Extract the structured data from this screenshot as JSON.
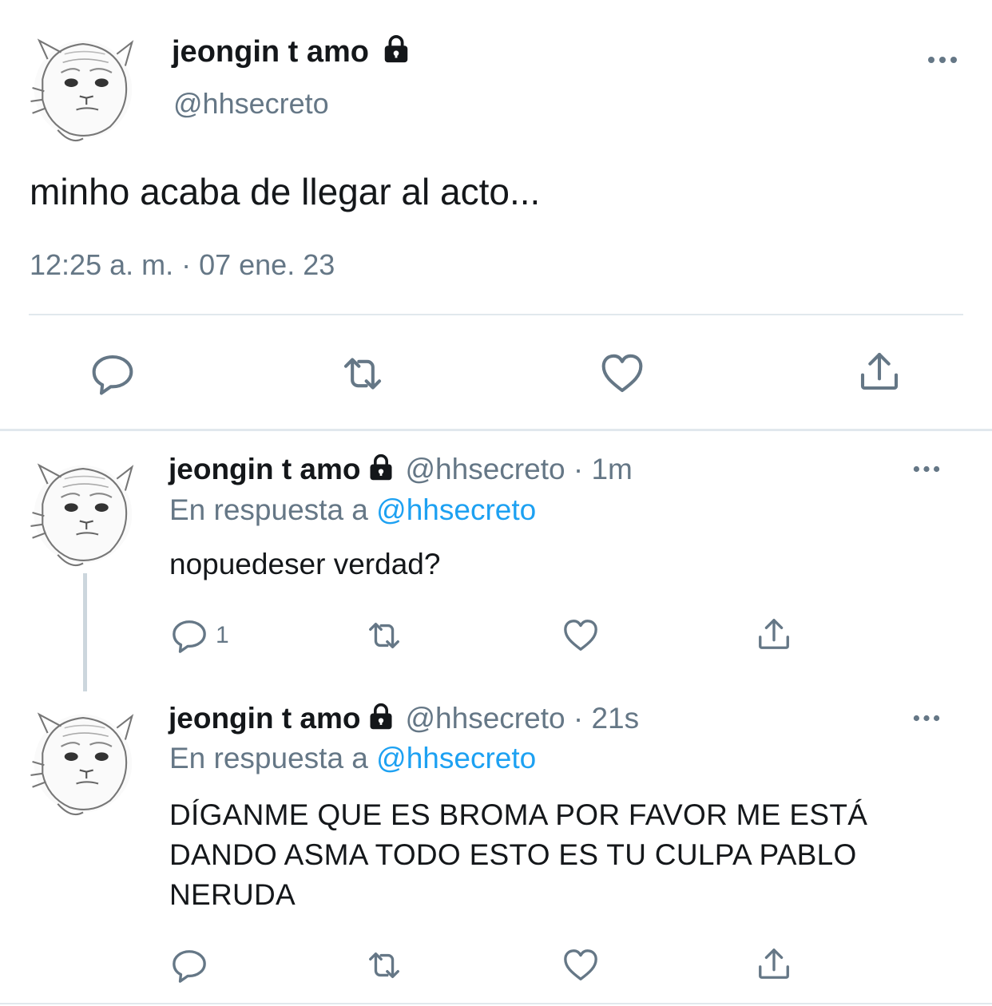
{
  "main_tweet": {
    "display_name": "jeongin t amo",
    "handle": "@hhsecreto",
    "text": "minho acaba de llegar al acto...",
    "timestamp": "12:25 a. m. · 07 ene. 23"
  },
  "replies": [
    {
      "display_name": "jeongin t amo",
      "handle": "@hhsecreto",
      "separator": "·",
      "time": "1m",
      "reply_prefix": "En respuesta a",
      "reply_to": "@hhsecreto",
      "text": "nopuedeser verdad?",
      "reply_count": "1"
    },
    {
      "display_name": "jeongin t amo",
      "handle": "@hhsecreto",
      "separator": "·",
      "time": "21s",
      "reply_prefix": "En respuesta a",
      "reply_to": "@hhsecreto",
      "text_lines": [
        "DÍGANME QUE ES BROMA POR FAVOR ME ESTÁ",
        "DANDO ASMA TODO ESTO ES TU CULPA PABLO",
        "NERUDA"
      ],
      "reply_count": ""
    }
  ],
  "icons": {
    "lock": "lock-icon",
    "more": "more-icon",
    "reply": "reply-icon",
    "retweet": "retweet-icon",
    "like": "heart-icon",
    "share": "share-icon"
  },
  "colors": {
    "text": "#14171a",
    "secondary": "#657786",
    "link": "#1da1f2",
    "divider": "#e1e8ed"
  }
}
